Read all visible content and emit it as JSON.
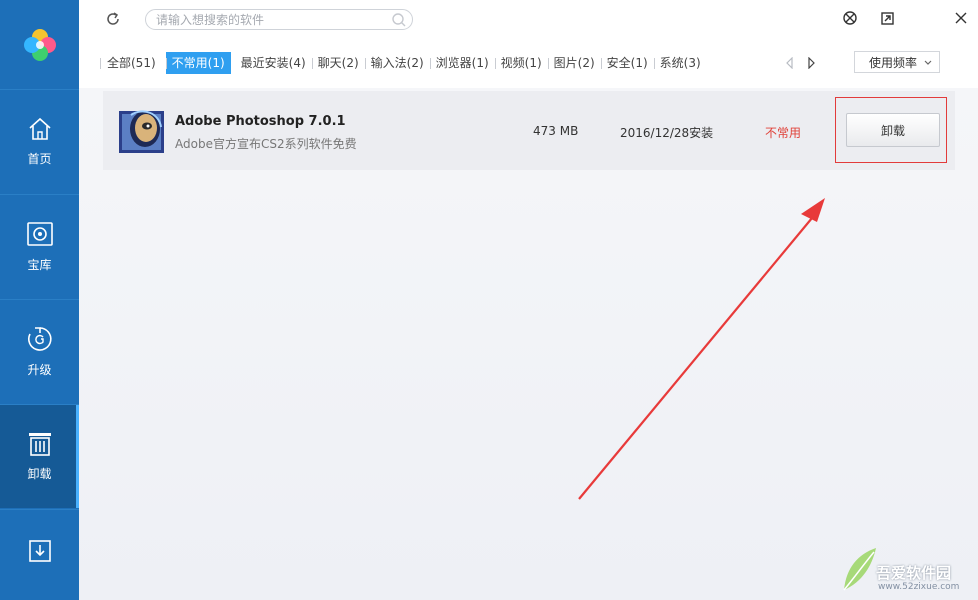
{
  "colors": {
    "sidebar": "#1d6fb8",
    "accent": "#2f9ff0",
    "alert": "#e0423a"
  },
  "sidebar": {
    "items": [
      {
        "label": "首页",
        "icon": "home-icon"
      },
      {
        "label": "宝库",
        "icon": "treasure-icon"
      },
      {
        "label": "升级",
        "icon": "upgrade-icon"
      },
      {
        "label": "卸载",
        "icon": "uninstall-icon",
        "active": true
      },
      {
        "label": "",
        "icon": "download-icon"
      }
    ]
  },
  "search": {
    "placeholder": "请输入想搜索的软件",
    "value": ""
  },
  "tabs": [
    {
      "label": "全部(51)"
    },
    {
      "label": "不常用(1)",
      "active": true
    },
    {
      "label": "最近安装(4)"
    },
    {
      "label": "聊天(2)"
    },
    {
      "label": "输入法(2)"
    },
    {
      "label": "浏览器(1)"
    },
    {
      "label": "视频(1)"
    },
    {
      "label": "图片(2)"
    },
    {
      "label": "安全(1)"
    },
    {
      "label": "系统(3)"
    }
  ],
  "sort": {
    "selected": "使用频率"
  },
  "app": {
    "name": "Adobe Photoshop 7.0.1",
    "description": "Adobe官方宣布CS2系列软件免费",
    "size": "473 MB",
    "install_date": "2016/12/28安装",
    "tag": "不常用",
    "action_label": "卸载"
  },
  "watermark": {
    "text": "吾爱软件园",
    "url": "www.52zixue.com"
  }
}
